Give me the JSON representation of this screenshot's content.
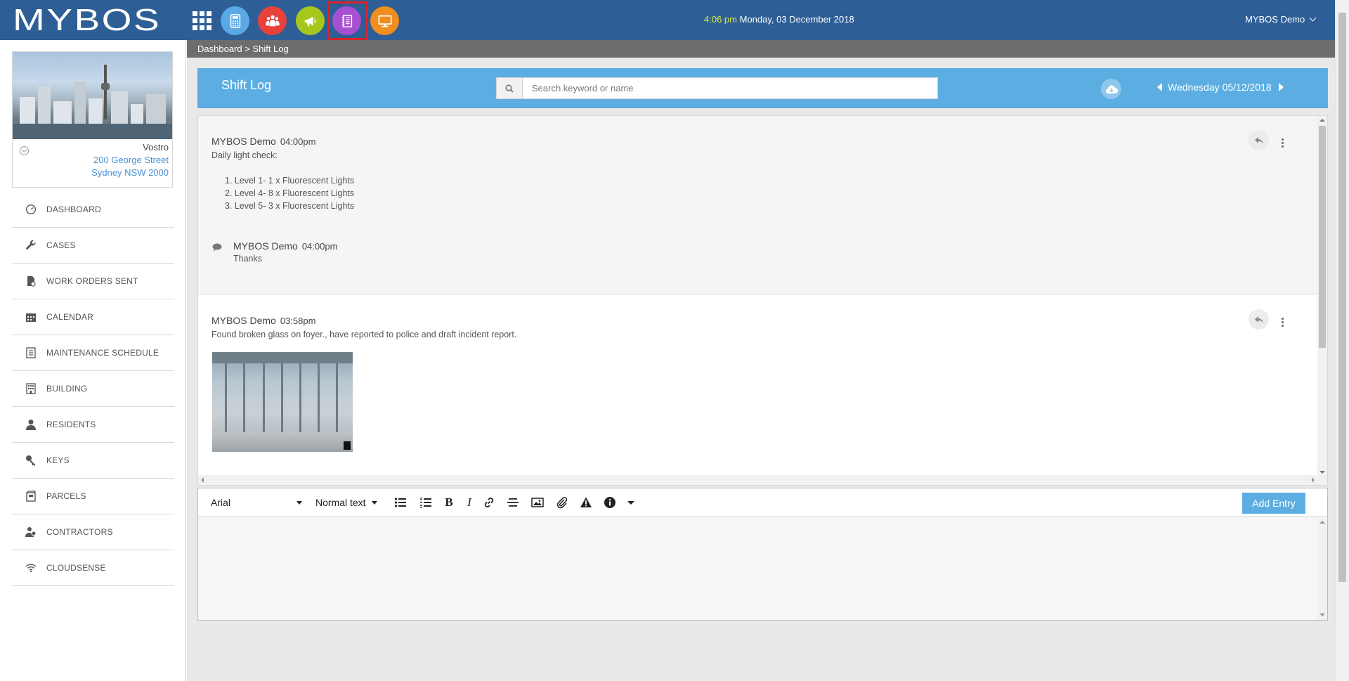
{
  "app": {
    "logo_text": "MYBOS",
    "clock_time": "4:06 pm",
    "clock_date": "Monday, 03 December 2018",
    "user_name": "MYBOS Demo",
    "colors": {
      "topbar": "#2d5e96",
      "accent": "#5caee2",
      "highlight": "#d8232a"
    }
  },
  "quick_launch": [
    {
      "icon": "calculator-icon",
      "color": "#5aa9e6"
    },
    {
      "icon": "people-icon",
      "color": "#e8413b"
    },
    {
      "icon": "megaphone-icon",
      "color": "#a6c81c"
    },
    {
      "icon": "notebook-icon",
      "color": "#a64fd1"
    },
    {
      "icon": "monitor-icon",
      "color": "#ef8d1f"
    }
  ],
  "building": {
    "name": "Vostro",
    "address_line1": "200 George Street",
    "address_line2": "Sydney NSW 2000"
  },
  "nav": [
    {
      "label": "DASHBOARD",
      "icon": "dashboard-icon"
    },
    {
      "label": "CASES",
      "icon": "wrench-icon"
    },
    {
      "label": "WORK ORDERS SENT",
      "icon": "document-icon"
    },
    {
      "label": "CALENDAR",
      "icon": "calendar-icon"
    },
    {
      "label": "MAINTENANCE SCHEDULE",
      "icon": "list-icon"
    },
    {
      "label": "BUILDING",
      "icon": "building-icon"
    },
    {
      "label": "RESIDENTS",
      "icon": "person-icon"
    },
    {
      "label": "KEYS",
      "icon": "key-icon"
    },
    {
      "label": "PARCELS",
      "icon": "parcel-icon"
    },
    {
      "label": "CONTRACTORS",
      "icon": "contractors-icon"
    },
    {
      "label": "CLOUDSENSE",
      "icon": "wifi-icon"
    }
  ],
  "breadcrumb": "Dashboard > Shift Log",
  "page": {
    "title": "Shift Log",
    "search_placeholder": "Search keyword or name",
    "date_label": "Wednesday 05/12/2018"
  },
  "entries": [
    {
      "author": "MYBOS Demo",
      "time": "04:00pm",
      "text": "Daily light check:",
      "list": [
        "1. Level 1- 1 x Fluorescent Lights",
        "2. Level 4- 8 x Fluorescent Lights",
        "3. Level 5- 3 x Fluorescent Lights"
      ],
      "comment": {
        "author": "MYBOS Demo",
        "time": "04:00pm",
        "text": "Thanks"
      }
    },
    {
      "author": "MYBOS Demo",
      "time": "03:58pm",
      "text": "Found broken glass on foyer., have reported to police and draft incident report."
    }
  ],
  "editor": {
    "font": "Arial",
    "style": "Normal text",
    "bold_glyph": "B",
    "italic_glyph": "I",
    "add_label": "Add Entry"
  }
}
